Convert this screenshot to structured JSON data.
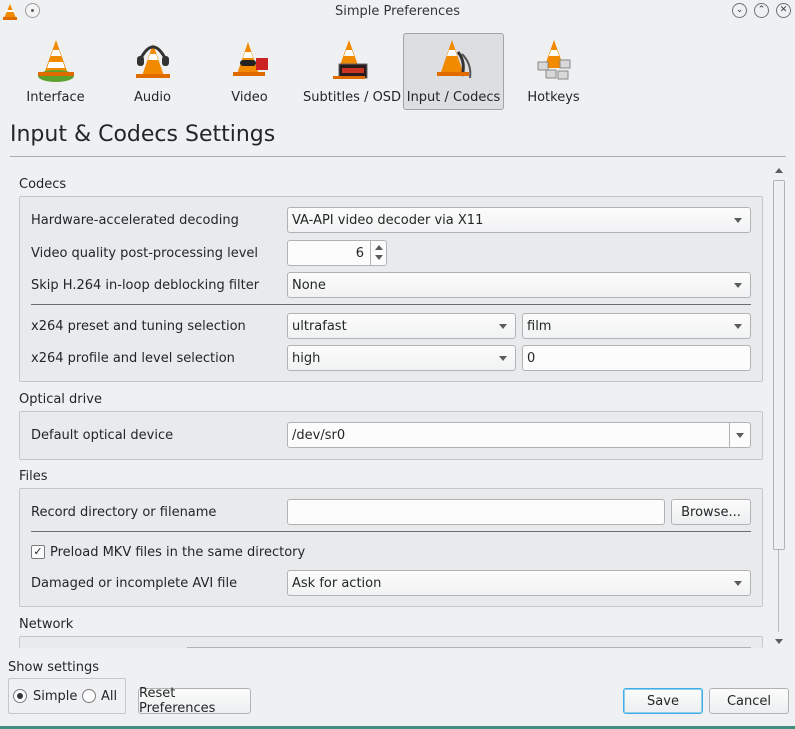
{
  "window": {
    "title": "Simple Preferences"
  },
  "categories": [
    {
      "label": "Interface",
      "icon": "vlc-cone-interface-icon",
      "active": false
    },
    {
      "label": "Audio",
      "icon": "vlc-cone-headphones-icon",
      "active": false
    },
    {
      "label": "Video",
      "icon": "vlc-cone-video-icon",
      "active": false
    },
    {
      "label": "Subtitles / OSD",
      "icon": "vlc-cone-subtitles-icon",
      "active": false
    },
    {
      "label": "Input / Codecs",
      "icon": "vlc-cone-cables-icon",
      "active": true
    },
    {
      "label": "Hotkeys",
      "icon": "vlc-cone-keys-icon",
      "active": false
    }
  ],
  "page": {
    "heading": "Input & Codecs Settings"
  },
  "codecs": {
    "title": "Codecs",
    "hw_decoding_label": "Hardware-accelerated decoding",
    "hw_decoding_value": "VA-API video decoder via X11",
    "pp_level_label": "Video quality post-processing level",
    "pp_level_value": "6",
    "skip_filter_label": "Skip H.264 in-loop deblocking filter",
    "skip_filter_value": "None",
    "x264_preset_label": "x264 preset and tuning selection",
    "x264_preset_value": "ultrafast",
    "x264_tune_value": "film",
    "x264_profile_label": "x264 profile and level selection",
    "x264_profile_value": "high",
    "x264_level_value": "0"
  },
  "optical": {
    "title": "Optical drive",
    "device_label": "Default optical device",
    "device_value": "/dev/sr0"
  },
  "files": {
    "title": "Files",
    "record_label": "Record directory or filename",
    "record_value": "",
    "browse_label": "Browse...",
    "preload_label": "Preload MKV files in the same directory",
    "preload_checked": true,
    "avi_label": "Damaged or incomplete AVI file",
    "avi_value": "Ask for action"
  },
  "network": {
    "title": "Network"
  },
  "footer": {
    "show_settings_label": "Show settings",
    "simple_label": "Simple",
    "all_label": "All",
    "selected_mode": "Simple",
    "reset_label": "Reset Preferences",
    "save_label": "Save",
    "cancel_label": "Cancel"
  },
  "colors": {
    "accent": "#3daee9",
    "window_bg": "#eff0f1",
    "vlc_orange": "#f28a00",
    "bottom_accent": "#3f8e7f"
  }
}
